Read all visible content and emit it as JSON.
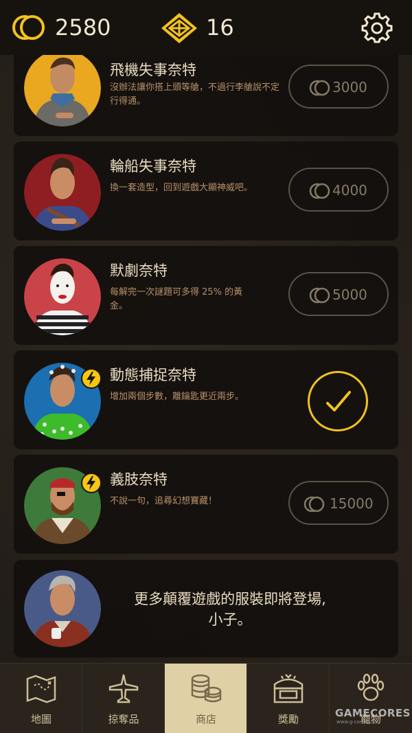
{
  "topbar": {
    "coins": "2580",
    "gems": "16",
    "coin_icon": "coin-stack-icon",
    "gem_icon": "gem-icon",
    "settings_icon": "gear-icon"
  },
  "items": [
    {
      "title": "飛機失事奈特",
      "desc": "沒辦法讓你搭上頭等艙，不過行李艙說不定行得通。",
      "price": "3000",
      "owned": false,
      "bolt": false,
      "bg": "#e9a820"
    },
    {
      "title": "輪船失事奈特",
      "desc": "換一套造型，回到遊戲大顯神威吧。",
      "price": "4000",
      "owned": false,
      "bolt": false,
      "bg": "#8e1e22"
    },
    {
      "title": "默劇奈特",
      "desc": "每解完一次謎題可多得 25% 的黃金。",
      "price": "5000",
      "owned": false,
      "bolt": false,
      "bg": "#c94349"
    },
    {
      "title": "動態捕捉奈特",
      "desc": "增加兩個步數，離鑰匙更近兩步。",
      "price": "",
      "owned": true,
      "bolt": true,
      "bg": "#1c6fb0"
    },
    {
      "title": "義肢奈特",
      "desc": "不說一句，追尋幻想寶藏！",
      "price": "15000",
      "owned": false,
      "bolt": true,
      "bg": "#3e7a3a"
    }
  ],
  "coming_soon": {
    "line1": "更多顛覆遊戲的服裝即將登場,",
    "line2": "小子。"
  },
  "nav": [
    {
      "label": "地圖",
      "icon": "map-icon"
    },
    {
      "label": "掠奪品",
      "icon": "airplane-icon"
    },
    {
      "label": "商店",
      "icon": "coins-icon"
    },
    {
      "label": "獎勵",
      "icon": "treasure-chest-icon"
    },
    {
      "label": "寵物",
      "icon": "paw-icon"
    }
  ],
  "watermark": {
    "text": "GAMECORES",
    "sub": "www.g-cores.com"
  },
  "colors": {
    "accent": "#f3c21e",
    "card_bg": "#14110d",
    "nav_active": "#e0d0a6"
  }
}
